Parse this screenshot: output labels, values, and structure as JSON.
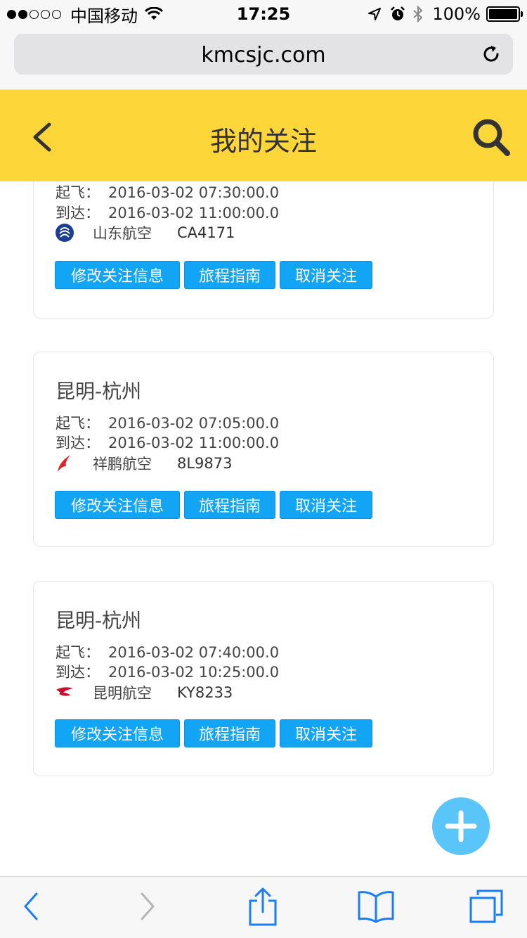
{
  "status_bar": {
    "carrier": "中国移动",
    "time": "17:25",
    "battery": "100%",
    "battery_level": 1.0
  },
  "browser": {
    "url": "kmcsjc.com"
  },
  "header": {
    "title": "我的关注"
  },
  "cards": [
    {
      "route": "",
      "depart_label": "起飞：",
      "depart_time": "2016-03-02 07:30:00.0",
      "arrive_label": "到达：",
      "arrive_time": "2016-03-02 11:00:00.0",
      "airline": "山东航空",
      "flight": "CA4171",
      "airline_icon": "shandong-airlines-logo-icon",
      "buttons": {
        "edit": "修改关注信息",
        "guide": "旅程指南",
        "cancel": "取消关注"
      }
    },
    {
      "route": "昆明-杭州",
      "depart_label": "起飞：",
      "depart_time": "2016-03-02 07:05:00.0",
      "arrive_label": "到达：",
      "arrive_time": "2016-03-02 11:00:00.0",
      "airline": "祥鹏航空",
      "flight": "8L9873",
      "airline_icon": "lucky-air-logo-icon",
      "buttons": {
        "edit": "修改关注信息",
        "guide": "旅程指南",
        "cancel": "取消关注"
      }
    },
    {
      "route": "昆明-杭州",
      "depart_label": "起飞：",
      "depart_time": "2016-03-02 07:40:00.0",
      "arrive_label": "到达：",
      "arrive_time": "2016-03-02 10:25:00.0",
      "airline": "昆明航空",
      "flight": "KY8233",
      "airline_icon": "kunming-airlines-logo-icon",
      "buttons": {
        "edit": "修改关注信息",
        "guide": "旅程指南",
        "cancel": "取消关注"
      }
    }
  ],
  "colors": {
    "header_bg": "#fdd63a",
    "button_bg": "#12a5f6",
    "fab_bg": "#5ac5f8",
    "ios_blue": "#1a7ef5"
  }
}
